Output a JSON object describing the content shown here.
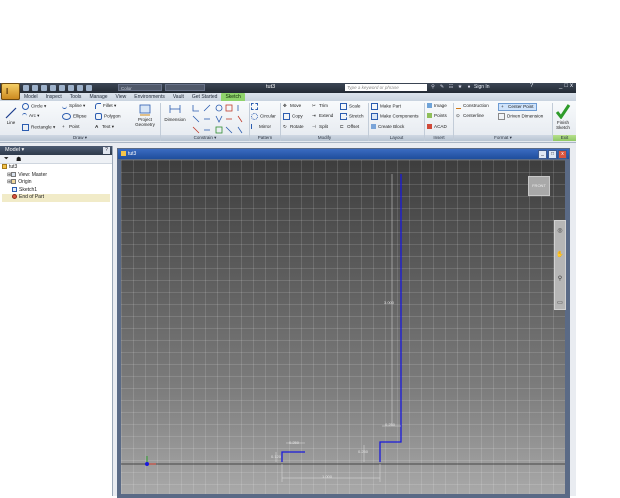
{
  "app": {
    "button_label": "I",
    "style_select": "Color",
    "doc_title": "tut3",
    "search_placeholder": "Type a keyword or phrase",
    "sign_in": "Sign In",
    "help": "?",
    "win_min": "_",
    "win_max": "□",
    "win_close": "x"
  },
  "tabs": [
    "Model",
    "Inspect",
    "Tools",
    "Manage",
    "View",
    "Environments",
    "Vault",
    "Get Started",
    "Sketch"
  ],
  "active_tab": "Sketch",
  "ribbon": {
    "draw": {
      "line": "Line",
      "circle": "Circle",
      "arc": "Arc",
      "rectangle": "Rectangle",
      "spline": "Spline",
      "ellipse": "Ellipse",
      "point": "Point",
      "fillet": "Fillet",
      "polygon": "Polygon",
      "text": "Text",
      "project_geometry_1": "Project",
      "project_geometry_2": "Geometry",
      "label": "Draw"
    },
    "constrain": {
      "dimension": "Dimension",
      "label": "Constrain"
    },
    "pattern": {
      "rectangular": "Rectangular",
      "circular": "Circular",
      "mirror": "Mirror",
      "label": "Pattern"
    },
    "modify": {
      "move": "Move",
      "copy": "Copy",
      "rotate": "Rotate",
      "trim": "Trim",
      "extend": "Extend",
      "split": "Split",
      "scale": "Scale",
      "stretch": "Stretch",
      "offset": "Offset",
      "label": "Modify"
    },
    "layout": {
      "make_part": "Make Part",
      "make_components": "Make Components",
      "create_block": "Create Block",
      "label": "Layout"
    },
    "insert": {
      "image": "Image",
      "points": "Points",
      "acad": "ACAD",
      "label": "Insert"
    },
    "format": {
      "construction": "Construction",
      "centerline": "Centerline",
      "center_point": "Center Point",
      "driven_dimension": "Driven Dimension",
      "label": "Format"
    },
    "exit": {
      "finish_1": "Finish",
      "finish_2": "Sketch",
      "label": "Exit"
    }
  },
  "browser": {
    "title": "Model",
    "help": "?",
    "tree": [
      {
        "label": "tut3",
        "indent": 0
      },
      {
        "label": "View: Master",
        "indent": 1
      },
      {
        "label": "Origin",
        "indent": 1
      },
      {
        "label": "Sketch1",
        "indent": 1
      },
      {
        "label": "End of Part",
        "indent": 1
      }
    ]
  },
  "graphics": {
    "title": "tut3",
    "viewcube": "FRONT",
    "dimensions": {
      "height": "3.000",
      "step_width": "0.250",
      "step_height": "0.250",
      "top_width": "0.250",
      "base_length": "1.000",
      "small_height": "0.120"
    }
  },
  "colors": {
    "sketch_line": "#1a1adc",
    "active_tab": "#8fd36b",
    "window_header": "#2b5cb0"
  }
}
